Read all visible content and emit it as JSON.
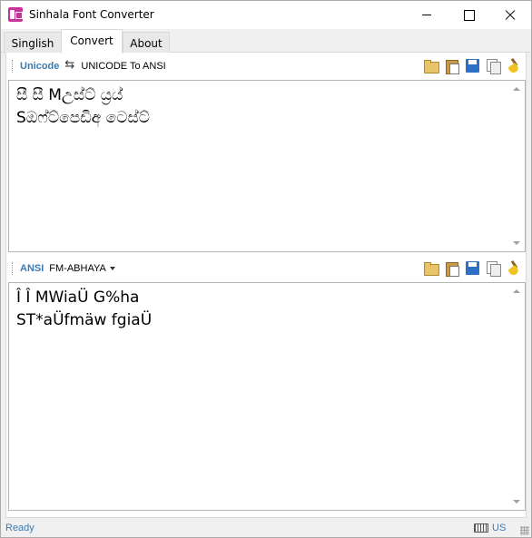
{
  "window": {
    "title": "Sinhala Font Converter"
  },
  "tabs": [
    {
      "label": "Singlish"
    },
    {
      "label": "Convert"
    },
    {
      "label": "About"
    }
  ],
  "unicode_toolbar": {
    "label": "Unicode",
    "action": "UNICODE To ANSI",
    "icons": [
      "folder-open-icon",
      "paste-icon",
      "save-icon",
      "copy-icon",
      "clear-icon"
    ]
  },
  "unicode_text": "සී සී Mඋස්ට් ය්‍රය්\nSඔෆ්ට්පෙඩිඅ ටෙස්ට්",
  "ansi_toolbar": {
    "label": "ANSI",
    "font": "FM-ABHAYA",
    "icons": [
      "folder-open-icon",
      "paste-icon",
      "save-icon",
      "copy-icon",
      "clear-icon"
    ]
  },
  "ansi_text": "Î Î MWiaÜ G%ha\nST*aÜfmäw fgiaÜ",
  "status": {
    "text": "Ready",
    "language": "US"
  },
  "colors": {
    "accent": "#3a7ab5",
    "app_icon": "#c8339a"
  }
}
